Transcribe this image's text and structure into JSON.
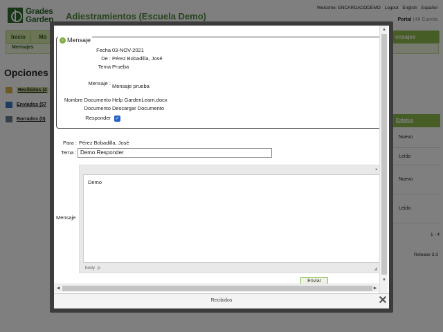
{
  "header": {
    "logo_line1": "Grades",
    "logo_line2": "Garden",
    "app_title": "Adiestramientos (Escuela Demo)",
    "welcome": "Welcome: ENCARGADODEMO",
    "logout": "Logout",
    "lang_en": "English",
    "lang_es": "Español",
    "portal": "Portal",
    "mi_cuenta": "Mi Cuenta"
  },
  "nav": {
    "inicio": "Inicio",
    "mo": "Mó",
    "mensajes": "ensajes",
    "sub_mensajes": "Mensajes"
  },
  "sidebar": {
    "title": "Opciones",
    "items": [
      {
        "label": "Recibidos (4",
        "icon": "folder-icon"
      },
      {
        "label": "Enviados (57",
        "icon": "sent-icon"
      },
      {
        "label": "Borrados (0)",
        "icon": "trash-icon"
      }
    ]
  },
  "table": {
    "status_header": "Estatus",
    "statuses": [
      "Nuevo",
      "Leído",
      "Nuevo",
      "Leído"
    ],
    "pager": "1 - 4"
  },
  "release": "Release 3.3",
  "modal": {
    "footer_title": "Recibidos",
    "message": {
      "legend": "Mensaje",
      "fecha_label": "Fecha",
      "fecha": "03-NOV-2021",
      "de_label": "De :",
      "de": "Pérez Bobadilla, José",
      "tema_label": "Tema",
      "tema": "Prueba",
      "mensaje_label": "Mensaje :",
      "mensaje": "Mensaje prueba",
      "nombre_doc_label": "Nombre Documento",
      "nombre_doc": "Help GardenLearn.docx",
      "documento_label": "Documento",
      "documento": "Descargar Documento",
      "responder_label": "Responder",
      "responder_checked": true
    },
    "reply": {
      "para_label": "Para :",
      "para": "Pérez Bobadilla, José",
      "tema_label": "Tema :",
      "tema_value": "Demo Responder",
      "mensaje_label": "Mensaje",
      "editor_text": "Demo",
      "status_path": [
        "body",
        "p"
      ],
      "send_label": "Enviar"
    }
  },
  "colors": {
    "accent_green": "#8dbd4b",
    "title_green": "#4c8a3a",
    "checkbox_blue": "#2563c9"
  }
}
